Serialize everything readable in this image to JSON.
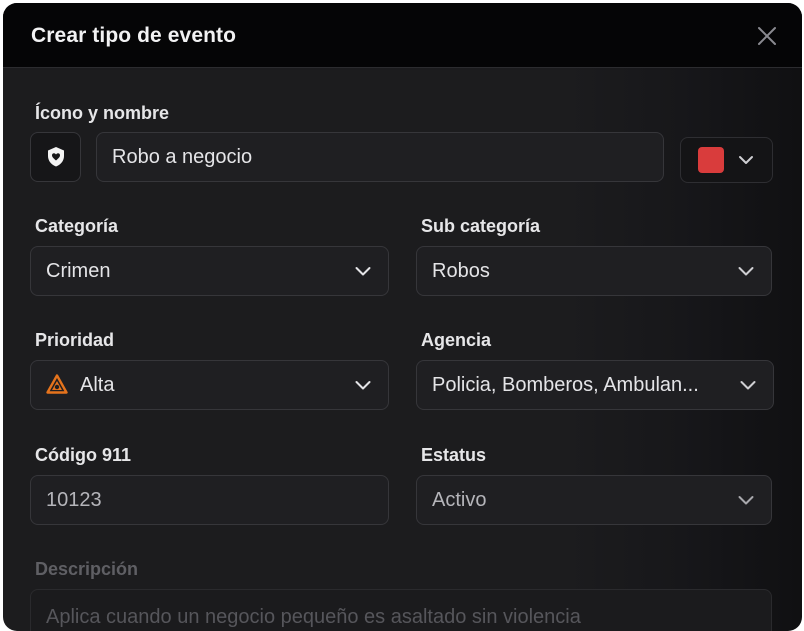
{
  "modal": {
    "title": "Crear tipo de evento"
  },
  "form": {
    "icon_name_label": "Ícono y nombre",
    "name_value": "Robo a negocio",
    "color": "#d93c3c",
    "category": {
      "label": "Categoría",
      "value": "Crimen"
    },
    "subcategory": {
      "label": "Sub categoría",
      "value": "Robos"
    },
    "priority": {
      "label": "Prioridad",
      "value": "Alta",
      "icon": "priority-high-icon",
      "icon_color": "#e5731c"
    },
    "agency": {
      "label": "Agencia",
      "value": "Policia, Bomberos, Ambulan..."
    },
    "code911": {
      "label": "Código 911",
      "value": "10123"
    },
    "status": {
      "label": "Estatus",
      "value": "Activo"
    },
    "description": {
      "label": "Descripción",
      "value": "Aplica cuando un negocio pequeño es asaltado sin violencia"
    }
  },
  "icons": {
    "close": "close-icon",
    "event_icon": "shield-heart-icon",
    "chevron": "chevron-down-icon"
  }
}
